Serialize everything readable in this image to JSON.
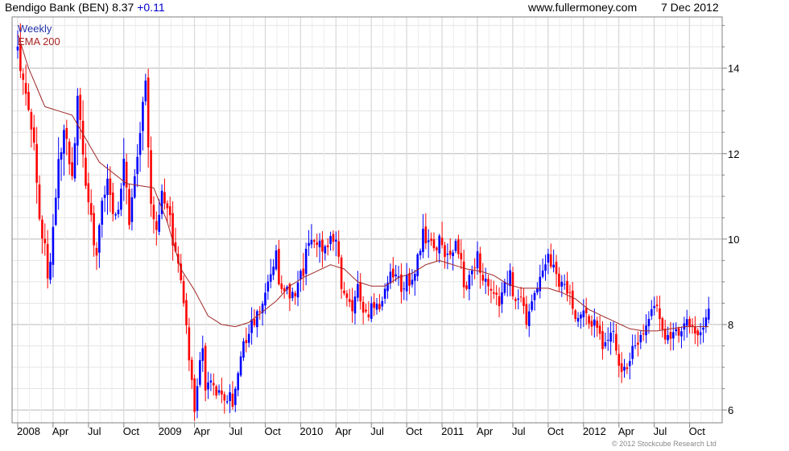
{
  "header": {
    "title": "Bendigo Bank (BEN) 8.37",
    "change": "+0.11",
    "site": "www.fullermoney.com",
    "date": "7 Dec 2012"
  },
  "copyright": "© 2012 Stockcube Research Ltd",
  "chart_data": {
    "type": "candlestick",
    "interval": "Weekly",
    "series": [
      {
        "name": "Weekly",
        "color_up": "#0000ff",
        "color_down": "#ff0000"
      },
      {
        "name": "EMA 200",
        "color": "#a03030"
      }
    ],
    "last": 8.37,
    "change": 0.11,
    "ylim": [
      5.7,
      15.2
    ],
    "y_ticks": [
      6,
      8,
      10,
      12,
      14
    ],
    "y_axis_side": "right",
    "x_ticks": [
      "2008",
      "Apr",
      "Jul",
      "Oct",
      "2009",
      "Apr",
      "Jul",
      "Oct",
      "2010",
      "Apr",
      "Jul",
      "Oct",
      "2011",
      "Apr",
      "Jul",
      "Oct",
      "2012",
      "Apr",
      "Jul",
      "Oct"
    ],
    "x_tick_weeks": [
      0,
      13,
      26,
      39,
      52,
      65,
      78,
      91,
      104,
      117,
      130,
      143,
      156,
      169,
      182,
      195,
      208,
      221,
      234,
      247
    ],
    "grid": true,
    "close_anchors": [
      [
        0,
        14.4
      ],
      [
        2,
        13.8
      ],
      [
        4,
        13.0
      ],
      [
        6,
        12.3
      ],
      [
        8,
        10.5
      ],
      [
        10,
        9.8
      ],
      [
        11,
        9.0
      ],
      [
        13,
        10.2
      ],
      [
        15,
        11.8
      ],
      [
        17,
        12.6
      ],
      [
        18,
        12.2
      ],
      [
        20,
        11.5
      ],
      [
        22,
        13.3
      ],
      [
        23,
        12.8
      ],
      [
        25,
        11.2
      ],
      [
        27,
        10.4
      ],
      [
        29,
        9.5
      ],
      [
        31,
        10.8
      ],
      [
        33,
        11.5
      ],
      [
        35,
        10.5
      ],
      [
        37,
        10.6
      ],
      [
        39,
        11.8
      ],
      [
        41,
        10.3
      ],
      [
        43,
        11.5
      ],
      [
        45,
        12.5
      ],
      [
        47,
        13.6
      ],
      [
        48,
        12.0
      ],
      [
        49,
        10.7
      ],
      [
        51,
        10.1
      ],
      [
        53,
        11.2
      ],
      [
        55,
        10.8
      ],
      [
        57,
        10.0
      ],
      [
        59,
        9.3
      ],
      [
        61,
        8.5
      ],
      [
        63,
        7.2
      ],
      [
        64,
        6.6
      ],
      [
        65,
        6.0
      ],
      [
        67,
        7.2
      ],
      [
        68,
        7.6
      ],
      [
        69,
        6.5
      ],
      [
        71,
        6.8
      ],
      [
        73,
        6.5
      ],
      [
        75,
        6.4
      ],
      [
        77,
        6.3
      ],
      [
        79,
        6.2
      ],
      [
        81,
        6.7
      ],
      [
        83,
        7.5
      ],
      [
        85,
        7.9
      ],
      [
        87,
        8.1
      ],
      [
        89,
        8.3
      ],
      [
        91,
        8.7
      ],
      [
        93,
        9.2
      ],
      [
        95,
        9.6
      ],
      [
        96,
        9.0
      ],
      [
        97,
        8.7
      ],
      [
        99,
        8.8
      ],
      [
        101,
        8.6
      ],
      [
        103,
        8.9
      ],
      [
        105,
        9.3
      ],
      [
        107,
        9.9
      ],
      [
        109,
        10.1
      ],
      [
        111,
        9.8
      ],
      [
        113,
        9.9
      ],
      [
        115,
        10.0
      ],
      [
        117,
        9.95
      ],
      [
        118,
        9.6
      ],
      [
        119,
        9.0
      ],
      [
        121,
        8.5
      ],
      [
        123,
        8.3
      ],
      [
        125,
        8.9
      ],
      [
        127,
        8.4
      ],
      [
        129,
        8.3
      ],
      [
        131,
        8.4
      ],
      [
        133,
        8.5
      ],
      [
        135,
        8.8
      ],
      [
        137,
        9.3
      ],
      [
        139,
        9.2
      ],
      [
        141,
        8.8
      ],
      [
        143,
        9.0
      ],
      [
        145,
        9.1
      ],
      [
        147,
        9.5
      ],
      [
        149,
        10.2
      ],
      [
        151,
        9.9
      ],
      [
        153,
        9.8
      ],
      [
        155,
        10.0
      ],
      [
        157,
        9.6
      ],
      [
        159,
        9.7
      ],
      [
        161,
        9.9
      ],
      [
        163,
        9.5
      ],
      [
        164,
        9.0
      ],
      [
        165,
        8.9
      ],
      [
        167,
        9.3
      ],
      [
        169,
        9.6
      ],
      [
        171,
        9.1
      ],
      [
        173,
        8.9
      ],
      [
        175,
        8.7
      ],
      [
        177,
        8.5
      ],
      [
        179,
        8.9
      ],
      [
        181,
        9.2
      ],
      [
        182,
        8.6
      ],
      [
        183,
        8.4
      ],
      [
        185,
        8.5
      ],
      [
        187,
        8.1
      ],
      [
        189,
        8.6
      ],
      [
        191,
        8.8
      ],
      [
        193,
        9.1
      ],
      [
        195,
        9.6
      ],
      [
        197,
        9.3
      ],
      [
        199,
        9.0
      ],
      [
        201,
        9.1
      ],
      [
        203,
        8.6
      ],
      [
        205,
        8.3
      ],
      [
        207,
        8.2
      ],
      [
        209,
        8.2
      ],
      [
        211,
        8.1
      ],
      [
        213,
        7.8
      ],
      [
        215,
        7.5
      ],
      [
        217,
        7.6
      ],
      [
        219,
        7.7
      ],
      [
        221,
        7.2
      ],
      [
        223,
        6.9
      ],
      [
        225,
        7.3
      ],
      [
        227,
        7.4
      ],
      [
        229,
        7.8
      ],
      [
        231,
        8.1
      ],
      [
        233,
        8.3
      ],
      [
        235,
        8.6
      ],
      [
        236,
        8.2
      ],
      [
        237,
        7.9
      ],
      [
        239,
        7.6
      ],
      [
        241,
        7.7
      ],
      [
        243,
        7.9
      ],
      [
        245,
        8.0
      ],
      [
        247,
        8.0
      ],
      [
        249,
        7.9
      ],
      [
        251,
        7.8
      ],
      [
        253,
        8.2
      ],
      [
        254,
        8.37
      ]
    ],
    "ema_anchors": [
      [
        0,
        14.8
      ],
      [
        4,
        14.0
      ],
      [
        10,
        13.1
      ],
      [
        20,
        12.9
      ],
      [
        30,
        11.8
      ],
      [
        40,
        11.3
      ],
      [
        50,
        11.2
      ],
      [
        55,
        10.4
      ],
      [
        60,
        9.3
      ],
      [
        65,
        8.8
      ],
      [
        70,
        8.2
      ],
      [
        75,
        8.0
      ],
      [
        80,
        7.95
      ],
      [
        85,
        8.05
      ],
      [
        90,
        8.3
      ],
      [
        95,
        8.55
      ],
      [
        100,
        8.9
      ],
      [
        105,
        9.1
      ],
      [
        110,
        9.25
      ],
      [
        115,
        9.4
      ],
      [
        120,
        9.3
      ],
      [
        125,
        9.0
      ],
      [
        130,
        8.9
      ],
      [
        135,
        8.9
      ],
      [
        140,
        9.1
      ],
      [
        145,
        9.2
      ],
      [
        150,
        9.4
      ],
      [
        155,
        9.5
      ],
      [
        160,
        9.4
      ],
      [
        165,
        9.3
      ],
      [
        170,
        9.25
      ],
      [
        175,
        9.15
      ],
      [
        180,
        8.95
      ],
      [
        185,
        8.85
      ],
      [
        190,
        8.85
      ],
      [
        195,
        8.85
      ],
      [
        200,
        8.75
      ],
      [
        205,
        8.6
      ],
      [
        210,
        8.35
      ],
      [
        215,
        8.2
      ],
      [
        220,
        8.05
      ],
      [
        225,
        7.9
      ],
      [
        230,
        7.85
      ],
      [
        235,
        7.85
      ],
      [
        240,
        7.9
      ],
      [
        245,
        7.95
      ],
      [
        250,
        7.95
      ],
      [
        254,
        7.95
      ]
    ]
  }
}
